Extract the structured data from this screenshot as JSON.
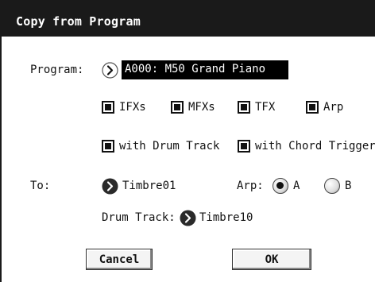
{
  "dialog": {
    "title": "Copy from Program"
  },
  "program": {
    "label": "Program:",
    "value": "A000: M50 Grand Piano"
  },
  "options": {
    "ifxs": "IFXs",
    "mfxs": "MFXs",
    "tfx": "TFX",
    "arp": "Arp",
    "with_drum_track": "with Drum Track",
    "with_chord_trigger": "with Chord Trigger"
  },
  "to": {
    "label": "To:",
    "value": "Timbre01"
  },
  "arp_select": {
    "label": "Arp:",
    "option_a": "A",
    "option_b": "B",
    "selected": "A"
  },
  "drum_track": {
    "label": "Drum Track:",
    "value": "Timbre10"
  },
  "buttons": {
    "cancel": "Cancel",
    "ok": "OK"
  },
  "icons": {
    "popup_arrow": "chevron-right-icon"
  },
  "colors": {
    "titlebar": "#1a1a1a",
    "field_bg": "#000000"
  }
}
